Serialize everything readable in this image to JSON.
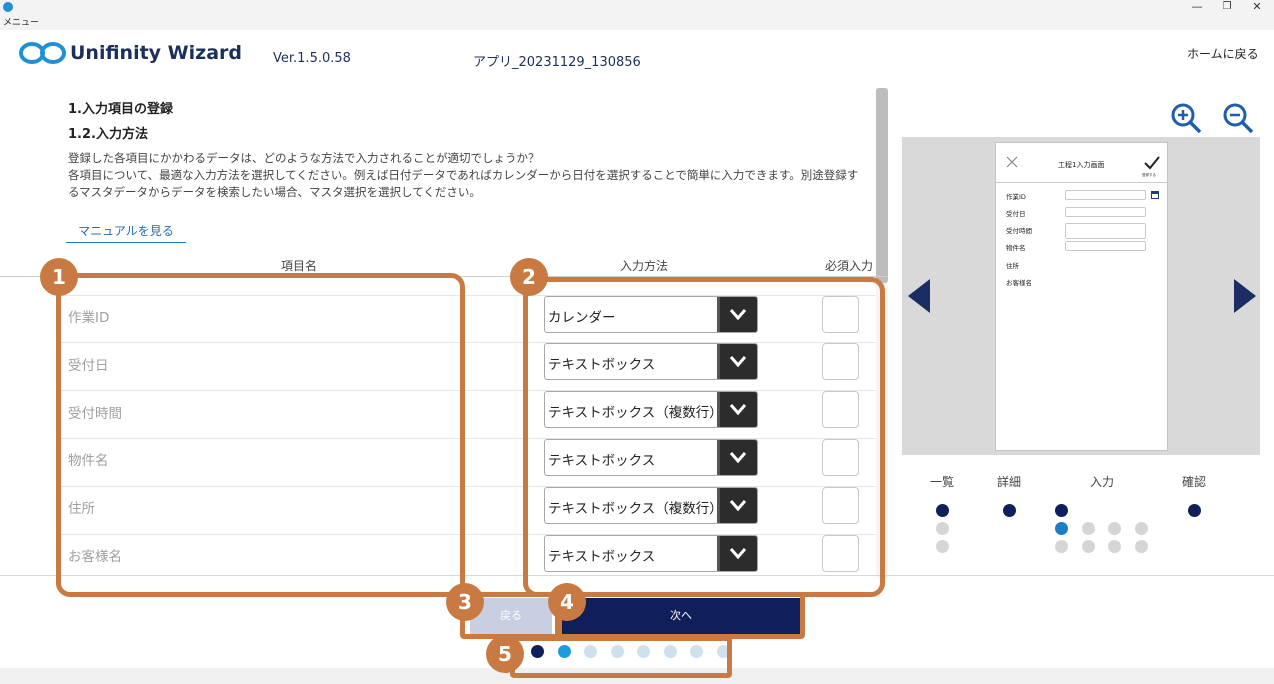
{
  "window": {
    "menu_label": "メニュー",
    "minimize_glyph": "—",
    "maximize_glyph": "❐",
    "close_glyph": "✕"
  },
  "header": {
    "app_name": "Unifinity Wizard",
    "version": "Ver.1.5.0.58",
    "app_title": "アプリ_20231129_130856",
    "home_link": "ホームに戻る",
    "logo_color": "#1f8fd6"
  },
  "content": {
    "section_title": "1.入力項目の登録",
    "subsection_title": "1.2.入力方法",
    "description": [
      "登録した各項目にかかわるデータは、どのような方法で入力されることが適切でしょうか？",
      "各項目について、最適な入力方法を選択してください。例えば日付データであればカレンダーから日付を選択することで簡単に入力できます。別途登録するマスタデータからデータを検索したい場合、マスタ選択を選択してください。"
    ],
    "manual_link": "マニュアルを見る"
  },
  "table": {
    "headers": {
      "item": "項目名",
      "method": "入力方法",
      "required": "必須入力"
    },
    "rows": [
      {
        "item": "作業ID",
        "method": "カレンダー",
        "required": false
      },
      {
        "item": "受付日",
        "method": "テキストボックス",
        "required": false
      },
      {
        "item": "受付時間",
        "method": "テキストボックス（複数行）",
        "required": false
      },
      {
        "item": "物件名",
        "method": "テキストボックス",
        "required": false
      },
      {
        "item": "住所",
        "method": "テキストボックス（複数行）",
        "required": false
      },
      {
        "item": "お客様名",
        "method": "テキストボックス",
        "required": false
      }
    ]
  },
  "callouts": {
    "badges": [
      "1",
      "2",
      "3",
      "4",
      "5"
    ],
    "color": "#c87a42"
  },
  "navigation": {
    "back_label": "戻る",
    "next_label": "次へ",
    "pager": {
      "total": 8,
      "done": 1,
      "current": 2
    },
    "colors": {
      "done": "#0f1f5a",
      "current": "#1e9be0",
      "pending": "#cfe0ee"
    }
  },
  "preview": {
    "screen_title": "工程1入力画面",
    "confirm_label": "登録する",
    "fields": [
      "作業ID",
      "受付日",
      "受付時間",
      "物件名",
      "住所",
      "お客様名"
    ],
    "steps": [
      {
        "label": "一覧",
        "dots": [
          "done",
          "pending",
          "pending"
        ]
      },
      {
        "label": "詳細",
        "dots": [
          "done"
        ]
      },
      {
        "label": "入力",
        "dots": [
          "done",
          "current",
          "pending",
          "pending",
          "pending",
          "pending",
          "pending",
          "pending",
          "pending"
        ]
      },
      {
        "label": "確認",
        "dots": [
          "done"
        ]
      }
    ],
    "colors": {
      "done": "#0f1f5a",
      "current": "#1e7ec5",
      "pending": "#d5d5d5"
    }
  },
  "icons": {
    "zoom_in": "zoom-in-icon",
    "zoom_out": "zoom-out-icon",
    "prev": "chevron-left-icon",
    "next": "chevron-right-icon",
    "dropdown": "chevron-down-icon"
  }
}
